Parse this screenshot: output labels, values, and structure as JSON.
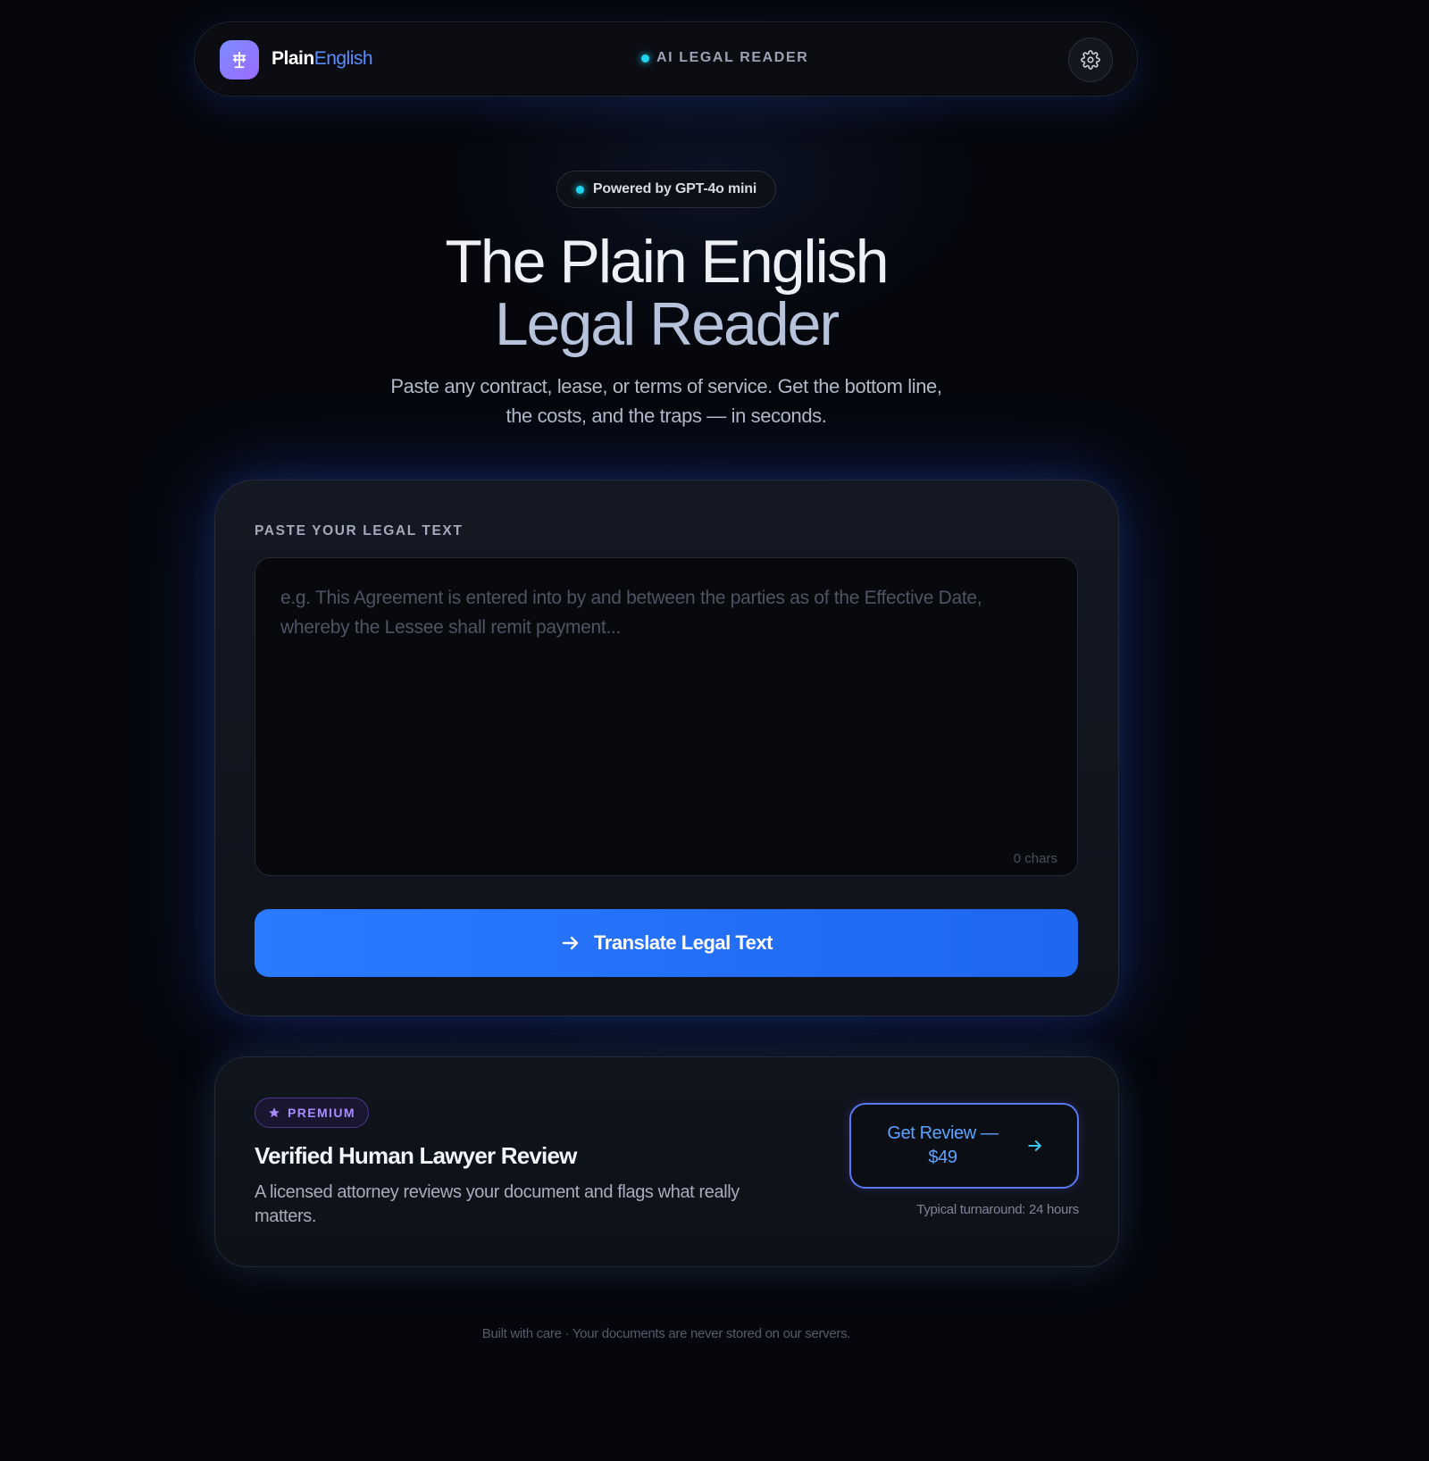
{
  "nav": {
    "brand_part1": "Plain",
    "brand_part2": "English",
    "center_label": "AI LEGAL READER",
    "logo_icon": "scale-icon",
    "settings_icon": "gear-icon"
  },
  "hero": {
    "badge": "Powered by GPT-4o mini",
    "title_line1": "The Plain English",
    "title_line2": "Legal Reader",
    "subtitle": "Paste any contract, lease, or terms of service. Get the bottom line, the costs, and the traps — in seconds."
  },
  "input_card": {
    "label": "PASTE YOUR LEGAL TEXT",
    "placeholder": "e.g. This Agreement is entered into by and between the parties as of the Effective Date, whereby the Lessee shall remit payment...",
    "value": "",
    "char_count": "0 chars",
    "button_label": "Translate Legal Text",
    "button_icon": "arrow-right-icon"
  },
  "premium": {
    "badge": "PREMIUM",
    "badge_icon": "star-icon",
    "title": "Verified Human Lawyer Review",
    "description": "A licensed attorney reviews your document and flags what really matters.",
    "button_label": "Get Review — $49",
    "button_icon": "arrow-right-icon",
    "turnaround": "Typical turnaround: 24 hours"
  },
  "footer": {
    "text": "Built with care · Your documents are never stored on our servers."
  },
  "colors": {
    "accent_blue": "#2a7bff",
    "accent_cyan": "#22d3ee",
    "accent_purple": "#a88cff",
    "background": "#05070d"
  }
}
